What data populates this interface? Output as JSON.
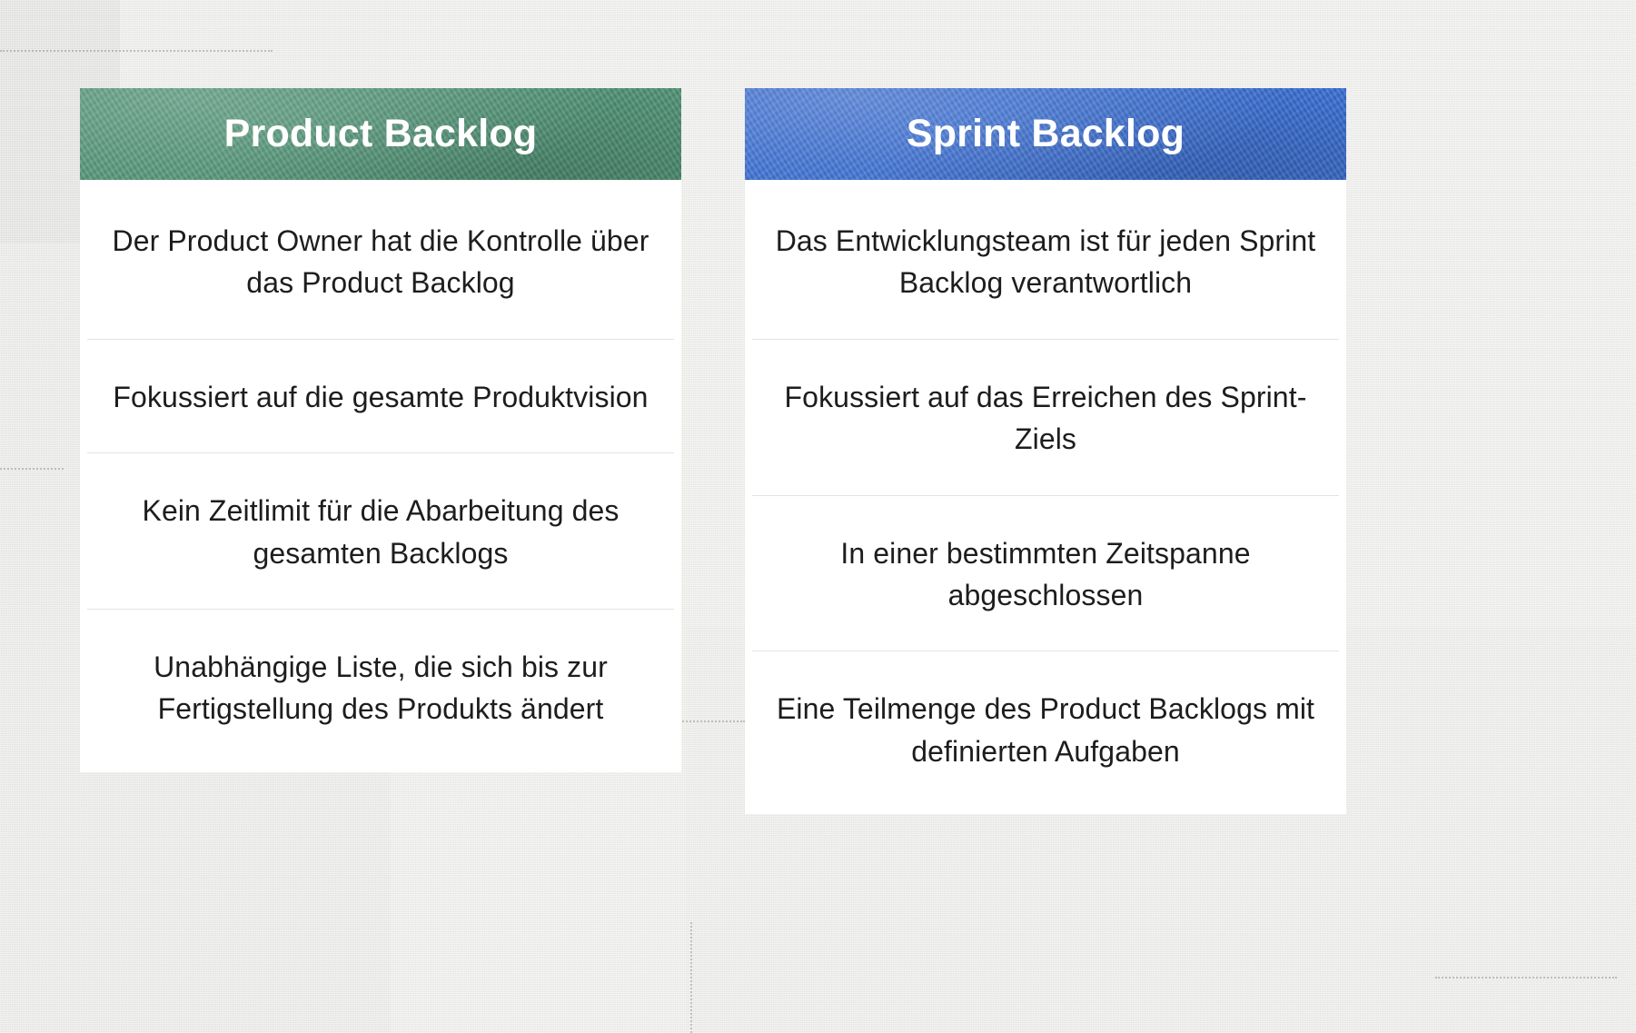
{
  "colors": {
    "product_header": "#4f9275",
    "sprint_header": "#3a6ed2",
    "card_background": "#ffffff",
    "page_background": "#efefee",
    "divider": "#e3e3e3",
    "body_text": "#1d1d1d",
    "header_text": "#ffffff"
  },
  "columns": [
    {
      "id": "product-backlog",
      "title": "Product Backlog",
      "accent": "#4f9275",
      "rows": [
        "Der Product Owner hat die Kontrolle über das Product Backlog",
        "Fokussiert auf die gesamte Produktvision",
        "Kein Zeitlimit für die Abarbeitung des gesamten Backlogs",
        "Unabhängige Liste, die sich bis zur Fertigstellung des Produkts ändert"
      ]
    },
    {
      "id": "sprint-backlog",
      "title": "Sprint Backlog",
      "accent": "#3a6ed2",
      "rows": [
        "Das Entwicklungsteam ist für jeden Sprint Backlog verantwortlich",
        "Fokussiert auf das Erreichen des Sprint-Ziels",
        "In einer bestimmten Zeitspanne abgeschlossen",
        "Eine Teilmenge des Product Backlogs mit definierten Aufgaben"
      ]
    }
  ]
}
